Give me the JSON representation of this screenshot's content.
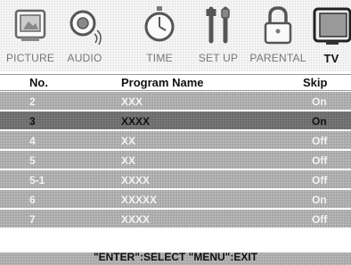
{
  "tabs": [
    {
      "label": "PICTURE",
      "icon": "picture-icon",
      "active": false
    },
    {
      "label": "AUDIO",
      "icon": "speaker-icon",
      "active": false
    },
    {
      "label": "TIME",
      "icon": "stopwatch-icon",
      "active": false
    },
    {
      "label": "SET UP",
      "icon": "tools-icon",
      "active": false
    },
    {
      "label": "PARENTAL",
      "icon": "padlock-icon",
      "active": false
    },
    {
      "label": "TV",
      "icon": "tv-icon",
      "active": true
    }
  ],
  "list": {
    "headers": {
      "no": "No.",
      "name": "Program Name",
      "skip": "Skip"
    },
    "rows": [
      {
        "no": "2",
        "name": "XXX",
        "skip": "On",
        "selected": false
      },
      {
        "no": "3",
        "name": "XXXX",
        "skip": "On",
        "selected": true
      },
      {
        "no": "4",
        "name": "XX",
        "skip": "Off",
        "selected": false
      },
      {
        "no": "5",
        "name": "XX",
        "skip": "Off",
        "selected": false
      },
      {
        "no": "5-1",
        "name": "XXXX",
        "skip": "Off",
        "selected": false
      },
      {
        "no": "6",
        "name": "XXXXX",
        "skip": "On",
        "selected": false
      },
      {
        "no": "7",
        "name": "XXXX",
        "skip": "Off",
        "selected": false
      }
    ]
  },
  "footer": {
    "hint": "\"ENTER\":SELECT \"MENU\":EXIT"
  }
}
